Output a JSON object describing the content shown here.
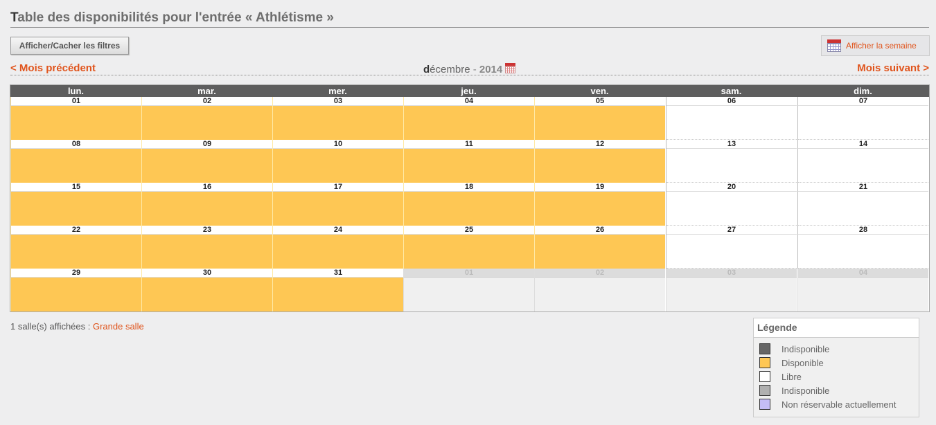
{
  "page": {
    "title_first": "T",
    "title_rest": "able des disponibilités pour l'entrée « Athlétisme »"
  },
  "toolbar": {
    "filter_button": "Afficher/Cacher les filtres",
    "week_button": "Afficher la semaine"
  },
  "nav": {
    "prev": "< Mois précédent",
    "next": "Mois suivant >",
    "month_first": "d",
    "month_rest": "écembre",
    "dash": " - ",
    "year": "2014"
  },
  "calendar": {
    "days": [
      "lun.",
      "mar.",
      "mer.",
      "jeu.",
      "ven.",
      "sam.",
      "dim."
    ],
    "weeks": [
      [
        {
          "n": "01",
          "s": "avail"
        },
        {
          "n": "02",
          "s": "avail"
        },
        {
          "n": "03",
          "s": "avail"
        },
        {
          "n": "04",
          "s": "avail"
        },
        {
          "n": "05",
          "s": "avail"
        },
        {
          "n": "06",
          "s": "free"
        },
        {
          "n": "07",
          "s": "free"
        }
      ],
      [
        {
          "n": "08",
          "s": "avail"
        },
        {
          "n": "09",
          "s": "avail"
        },
        {
          "n": "10",
          "s": "avail"
        },
        {
          "n": "11",
          "s": "avail"
        },
        {
          "n": "12",
          "s": "avail"
        },
        {
          "n": "13",
          "s": "free"
        },
        {
          "n": "14",
          "s": "free"
        }
      ],
      [
        {
          "n": "15",
          "s": "avail"
        },
        {
          "n": "16",
          "s": "avail"
        },
        {
          "n": "17",
          "s": "avail"
        },
        {
          "n": "18",
          "s": "avail"
        },
        {
          "n": "19",
          "s": "avail"
        },
        {
          "n": "20",
          "s": "free"
        },
        {
          "n": "21",
          "s": "free"
        }
      ],
      [
        {
          "n": "22",
          "s": "avail"
        },
        {
          "n": "23",
          "s": "avail"
        },
        {
          "n": "24",
          "s": "avail"
        },
        {
          "n": "25",
          "s": "avail"
        },
        {
          "n": "26",
          "s": "avail"
        },
        {
          "n": "27",
          "s": "free"
        },
        {
          "n": "28",
          "s": "free"
        }
      ],
      [
        {
          "n": "29",
          "s": "avail"
        },
        {
          "n": "30",
          "s": "avail"
        },
        {
          "n": "31",
          "s": "avail"
        },
        {
          "n": "01",
          "s": "out"
        },
        {
          "n": "02",
          "s": "out"
        },
        {
          "n": "03",
          "s": "out"
        },
        {
          "n": "04",
          "s": "out"
        }
      ]
    ]
  },
  "footer": {
    "rooms_text": "1 salle(s) affichées : ",
    "room_link": "Grande salle"
  },
  "legend": {
    "title": "Légende",
    "items": [
      {
        "label": "Indisponible",
        "color": "#666666"
      },
      {
        "label": "Disponible",
        "color": "#fec754"
      },
      {
        "label": "Libre",
        "color": "#ffffff"
      },
      {
        "label": "Indisponible",
        "color": "#b0b0b0"
      },
      {
        "label": "Non réservable actuellement",
        "color": "#c4bdf5"
      }
    ]
  },
  "colors": {
    "accent": "#e0541c",
    "available": "#fec754",
    "header": "#5e5e5e"
  }
}
